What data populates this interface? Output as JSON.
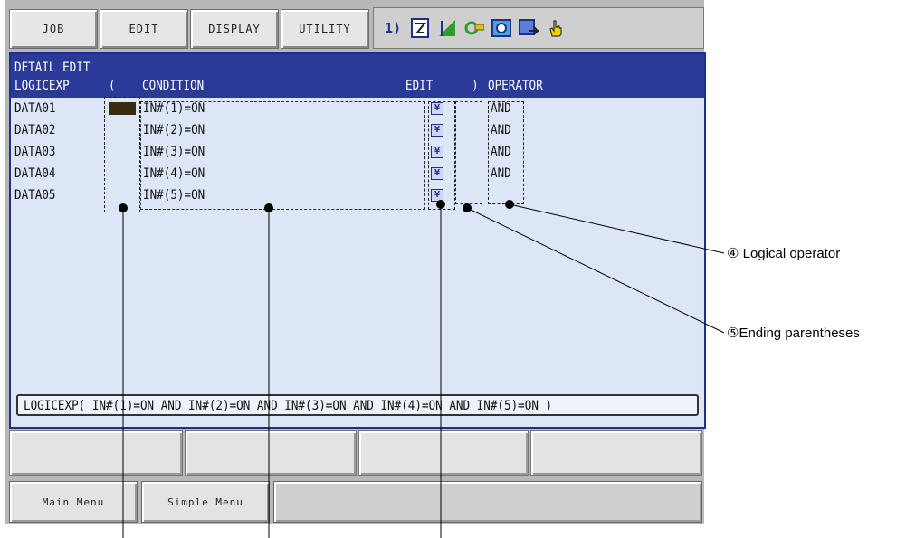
{
  "menu": {
    "job": "JOB",
    "edit": "EDIT",
    "display": "DISPLAY",
    "utility": "UTILITY"
  },
  "status_icons": [
    "ids-icon",
    "edit-box-icon",
    "signal-icon",
    "tool-icon",
    "camera-icon",
    "record-icon",
    "hand-icon"
  ],
  "window": {
    "title": "DETAIL EDIT",
    "headers": {
      "logicexp": "LOGICEXP",
      "open_paren": "(",
      "condition": "CONDITION",
      "edit": "EDIT",
      "close_paren": ")",
      "operator": "OPERATOR"
    },
    "rows": [
      {
        "name": "DATA01",
        "condition": "IN#(1)=ON",
        "operator": "AND"
      },
      {
        "name": "DATA02",
        "condition": "IN#(2)=ON",
        "operator": "AND"
      },
      {
        "name": "DATA03",
        "condition": "IN#(3)=ON",
        "operator": "AND"
      },
      {
        "name": "DATA04",
        "condition": "IN#(4)=ON",
        "operator": "AND"
      },
      {
        "name": "DATA05",
        "condition": "IN#(5)=ON",
        "operator": ""
      }
    ],
    "expression": "LOGICEXP( IN#(1)=ON AND IN#(2)=ON AND IN#(3)=ON AND IN#(4)=ON AND IN#(5)=ON )"
  },
  "bottom": {
    "main_menu": "Main Menu",
    "simple_menu": "Simple Menu"
  },
  "callouts": {
    "logical_operator": "④ Logical operator",
    "ending_parentheses": "⑤Ending parentheses"
  }
}
